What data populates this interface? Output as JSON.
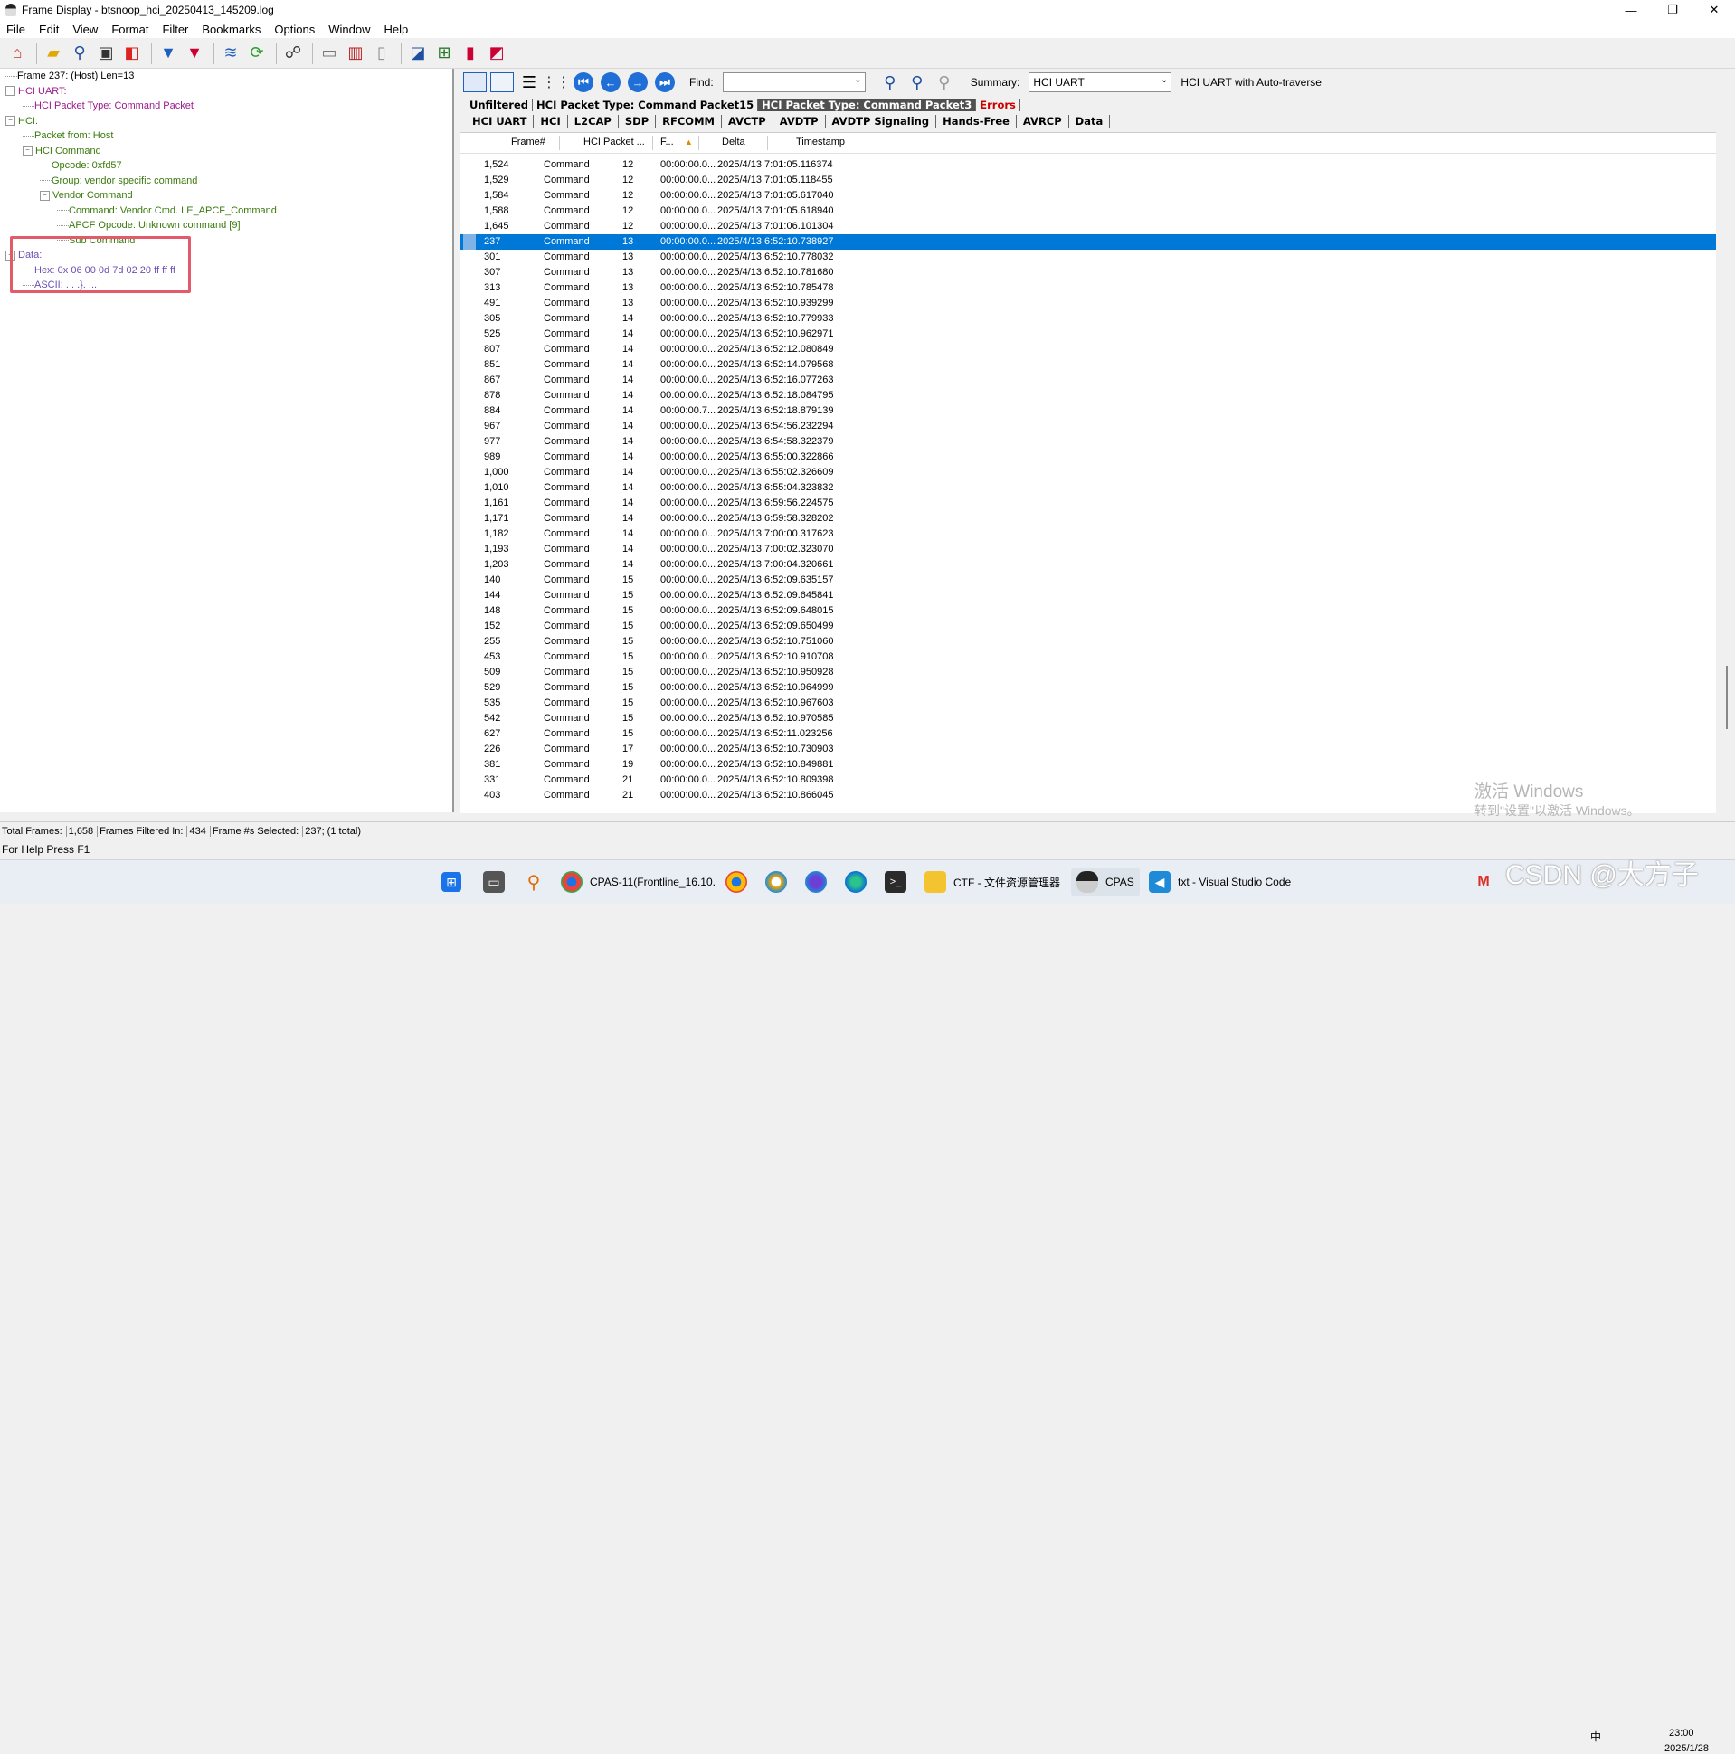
{
  "window": {
    "title": "Frame Display - btsnoop_hci_20250413_145209.log",
    "controls": [
      "—",
      "❐",
      "✕"
    ]
  },
  "menu": [
    "File",
    "Edit",
    "View",
    "Format",
    "Filter",
    "Bookmarks",
    "Options",
    "Window",
    "Help"
  ],
  "toolbar_icons": [
    "home-icon",
    "open-folder-icon",
    "magnifier-icon",
    "save-icon",
    "decode-icon",
    "filter-icon",
    "filter-clear-icon",
    "layers-icon",
    "refresh-icon",
    "binoculars-icon",
    "page-icon",
    "book-icon",
    "open-book-icon",
    "chart-icon",
    "network-icon",
    "bar-chart-icon",
    "line-chart-icon"
  ],
  "tree": [
    {
      "text": "Frame 237: (Host) Len=13",
      "indent": 0,
      "color": "black",
      "exp": ""
    },
    {
      "text": "HCI UART:",
      "indent": 0,
      "color": "pink",
      "exp": "−"
    },
    {
      "text": "HCI Packet Type: Command Packet",
      "indent": 1,
      "color": "pink",
      "exp": ""
    },
    {
      "text": "HCI:",
      "indent": 0,
      "color": "green",
      "exp": "−"
    },
    {
      "text": "Packet from: Host",
      "indent": 1,
      "color": "green",
      "exp": ""
    },
    {
      "text": "HCI Command",
      "indent": 1,
      "color": "green",
      "exp": "−"
    },
    {
      "text": "Opcode: 0xfd57",
      "indent": 2,
      "color": "green",
      "exp": ""
    },
    {
      "text": "Group: vendor specific command",
      "indent": 2,
      "color": "green",
      "exp": ""
    },
    {
      "text": "Vendor Command",
      "indent": 2,
      "color": "green",
      "exp": "−"
    },
    {
      "text": "Command: Vendor Cmd. LE_APCF_Command",
      "indent": 3,
      "color": "green",
      "exp": ""
    },
    {
      "text": "APCF Opcode: Unknown command [9]",
      "indent": 3,
      "color": "green",
      "exp": ""
    },
    {
      "text": "Sub Command",
      "indent": 3,
      "color": "green",
      "exp": ""
    },
    {
      "text": "Data:",
      "indent": 0,
      "color": "purple",
      "exp": "−"
    },
    {
      "text": "Hex: 0x 06 00 0d 7d 02 20 ff ff ff",
      "indent": 1,
      "color": "purple",
      "exp": ""
    },
    {
      "text": "ASCII: . . .}. ...",
      "indent": 1,
      "color": "purple",
      "exp": ""
    }
  ],
  "right_toolbar": {
    "find_label": "Find:",
    "find_value": "",
    "summary_label": "Summary:",
    "summary_value": "HCI UART",
    "summary_note": "HCI UART with Auto-traverse"
  },
  "tabs_row1": [
    {
      "label": "Unfiltered",
      "state": "normal"
    },
    {
      "label": "HCI Packet Type: Command Packet15",
      "state": "normal"
    },
    {
      "label": "HCI Packet Type: Command Packet3",
      "state": "active"
    },
    {
      "label": "Errors",
      "state": "error"
    }
  ],
  "tabs_row2": [
    "HCI UART",
    "HCI",
    "L2CAP",
    "SDP",
    "RFCOMM",
    "AVCTP",
    "AVDTP",
    "AVDTP Signaling",
    "Hands-Free",
    "AVRCP",
    "Data"
  ],
  "columns": [
    "Frame#",
    "HCI Packet ...",
    "F...",
    "Delta",
    "Timestamp"
  ],
  "sort_indicator": "▲",
  "rows": [
    [
      "1,524",
      "Command",
      "12",
      "00:00:00.0...",
      "2025/4/13 7:01:05.116374"
    ],
    [
      "1,529",
      "Command",
      "12",
      "00:00:00.0...",
      "2025/4/13 7:01:05.118455"
    ],
    [
      "1,584",
      "Command",
      "12",
      "00:00:00.0...",
      "2025/4/13 7:01:05.617040"
    ],
    [
      "1,588",
      "Command",
      "12",
      "00:00:00.0...",
      "2025/4/13 7:01:05.618940"
    ],
    [
      "1,645",
      "Command",
      "12",
      "00:00:00.0...",
      "2025/4/13 7:01:06.101304"
    ],
    [
      "237",
      "Command",
      "13",
      "00:00:00.0...",
      "2025/4/13 6:52:10.738927"
    ],
    [
      "301",
      "Command",
      "13",
      "00:00:00.0...",
      "2025/4/13 6:52:10.778032"
    ],
    [
      "307",
      "Command",
      "13",
      "00:00:00.0...",
      "2025/4/13 6:52:10.781680"
    ],
    [
      "313",
      "Command",
      "13",
      "00:00:00.0...",
      "2025/4/13 6:52:10.785478"
    ],
    [
      "491",
      "Command",
      "13",
      "00:00:00.0...",
      "2025/4/13 6:52:10.939299"
    ],
    [
      "305",
      "Command",
      "14",
      "00:00:00.0...",
      "2025/4/13 6:52:10.779933"
    ],
    [
      "525",
      "Command",
      "14",
      "00:00:00.0...",
      "2025/4/13 6:52:10.962971"
    ],
    [
      "807",
      "Command",
      "14",
      "00:00:00.0...",
      "2025/4/13 6:52:12.080849"
    ],
    [
      "851",
      "Command",
      "14",
      "00:00:00.0...",
      "2025/4/13 6:52:14.079568"
    ],
    [
      "867",
      "Command",
      "14",
      "00:00:00.0...",
      "2025/4/13 6:52:16.077263"
    ],
    [
      "878",
      "Command",
      "14",
      "00:00:00.0...",
      "2025/4/13 6:52:18.084795"
    ],
    [
      "884",
      "Command",
      "14",
      "00:00:00.7...",
      "2025/4/13 6:52:18.879139"
    ],
    [
      "967",
      "Command",
      "14",
      "00:00:00.0...",
      "2025/4/13 6:54:56.232294"
    ],
    [
      "977",
      "Command",
      "14",
      "00:00:00.0...",
      "2025/4/13 6:54:58.322379"
    ],
    [
      "989",
      "Command",
      "14",
      "00:00:00.0...",
      "2025/4/13 6:55:00.322866"
    ],
    [
      "1,000",
      "Command",
      "14",
      "00:00:00.0...",
      "2025/4/13 6:55:02.326609"
    ],
    [
      "1,010",
      "Command",
      "14",
      "00:00:00.0...",
      "2025/4/13 6:55:04.323832"
    ],
    [
      "1,161",
      "Command",
      "14",
      "00:00:00.0...",
      "2025/4/13 6:59:56.224575"
    ],
    [
      "1,171",
      "Command",
      "14",
      "00:00:00.0...",
      "2025/4/13 6:59:58.328202"
    ],
    [
      "1,182",
      "Command",
      "14",
      "00:00:00.0...",
      "2025/4/13 7:00:00.317623"
    ],
    [
      "1,193",
      "Command",
      "14",
      "00:00:00.0...",
      "2025/4/13 7:00:02.323070"
    ],
    [
      "1,203",
      "Command",
      "14",
      "00:00:00.0...",
      "2025/4/13 7:00:04.320661"
    ],
    [
      "140",
      "Command",
      "15",
      "00:00:00.0...",
      "2025/4/13 6:52:09.635157"
    ],
    [
      "144",
      "Command",
      "15",
      "00:00:00.0...",
      "2025/4/13 6:52:09.645841"
    ],
    [
      "148",
      "Command",
      "15",
      "00:00:00.0...",
      "2025/4/13 6:52:09.648015"
    ],
    [
      "152",
      "Command",
      "15",
      "00:00:00.0...",
      "2025/4/13 6:52:09.650499"
    ],
    [
      "255",
      "Command",
      "15",
      "00:00:00.0...",
      "2025/4/13 6:52:10.751060"
    ],
    [
      "453",
      "Command",
      "15",
      "00:00:00.0...",
      "2025/4/13 6:52:10.910708"
    ],
    [
      "509",
      "Command",
      "15",
      "00:00:00.0...",
      "2025/4/13 6:52:10.950928"
    ],
    [
      "529",
      "Command",
      "15",
      "00:00:00.0...",
      "2025/4/13 6:52:10.964999"
    ],
    [
      "535",
      "Command",
      "15",
      "00:00:00.0...",
      "2025/4/13 6:52:10.967603"
    ],
    [
      "542",
      "Command",
      "15",
      "00:00:00.0...",
      "2025/4/13 6:52:10.970585"
    ],
    [
      "627",
      "Command",
      "15",
      "00:00:00.0...",
      "2025/4/13 6:52:11.023256"
    ],
    [
      "226",
      "Command",
      "17",
      "00:00:00.0...",
      "2025/4/13 6:52:10.730903"
    ],
    [
      "381",
      "Command",
      "19",
      "00:00:00.0...",
      "2025/4/13 6:52:10.849881"
    ],
    [
      "331",
      "Command",
      "21",
      "00:00:00.0...",
      "2025/4/13 6:52:10.809398"
    ],
    [
      "403",
      "Command",
      "21",
      "00:00:00.0...",
      "2025/4/13 6:52:10.866045"
    ]
  ],
  "selected_row_index": 5,
  "status": {
    "total_frames_label": "Total Frames:",
    "total_frames": "1,658",
    "filtered_label": "Frames Filtered In:",
    "filtered": "434",
    "selected_label": "Frame #s Selected:",
    "selected": "237; (1 total)",
    "help": "For Help Press F1"
  },
  "watermark": {
    "line1": "激活 Windows",
    "line2": "转到\"设置\"以激活 Windows。"
  },
  "taskbar": {
    "items": [
      {
        "label": "CPAS-11(Frontline_16.10.",
        "icon": "chrome-icon"
      },
      {
        "label": "CTF - 文件资源管理器",
        "icon": "folder-icon"
      },
      {
        "label": "CPAS",
        "icon": "cpas-icon"
      },
      {
        "label": "txt - Visual Studio Code",
        "icon": "vscode-icon"
      }
    ],
    "ime": "中",
    "time": "23:00",
    "date": "2025/1/28",
    "csdn": "CSDN @大方子"
  }
}
